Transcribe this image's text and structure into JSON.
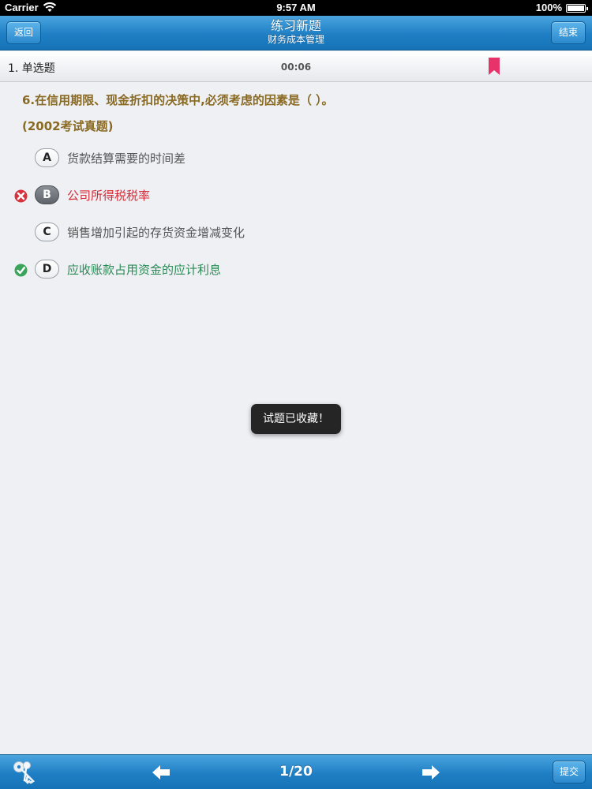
{
  "status_bar": {
    "carrier": "Carrier",
    "time": "9:57 AM",
    "battery": "100%"
  },
  "nav": {
    "back_label": "返回",
    "title": "练习新题",
    "subtitle": "财务成本管理",
    "end_label": "结束"
  },
  "question_header": {
    "type": "1. 单选题",
    "timer": "00:06",
    "bookmark_color": "#e8336a"
  },
  "question": {
    "text": "6.在信用期限、现金折扣的决策中,必须考虑的因素是（ ）。",
    "source": "(2002考试真题)"
  },
  "options": [
    {
      "letter": "A",
      "text": "货款结算需要的时间差",
      "state": "normal"
    },
    {
      "letter": "B",
      "text": "公司所得税税率",
      "state": "wrong"
    },
    {
      "letter": "C",
      "text": "销售增加引起的存货资金增减变化",
      "state": "normal"
    },
    {
      "letter": "D",
      "text": "应收账款占用资金的应计利息",
      "state": "correct"
    }
  ],
  "toast": {
    "message": "试题已收藏！"
  },
  "toolbar": {
    "keys_icon": "keys-icon",
    "prev_icon": "arrow-left-icon",
    "page_counter": "1/20",
    "next_icon": "arrow-right-icon",
    "submit_label": "提交"
  },
  "colors": {
    "accent": "#1f7fc4",
    "question_text": "#8a6a22",
    "wrong": "#d42a35",
    "correct": "#2b8a56"
  }
}
